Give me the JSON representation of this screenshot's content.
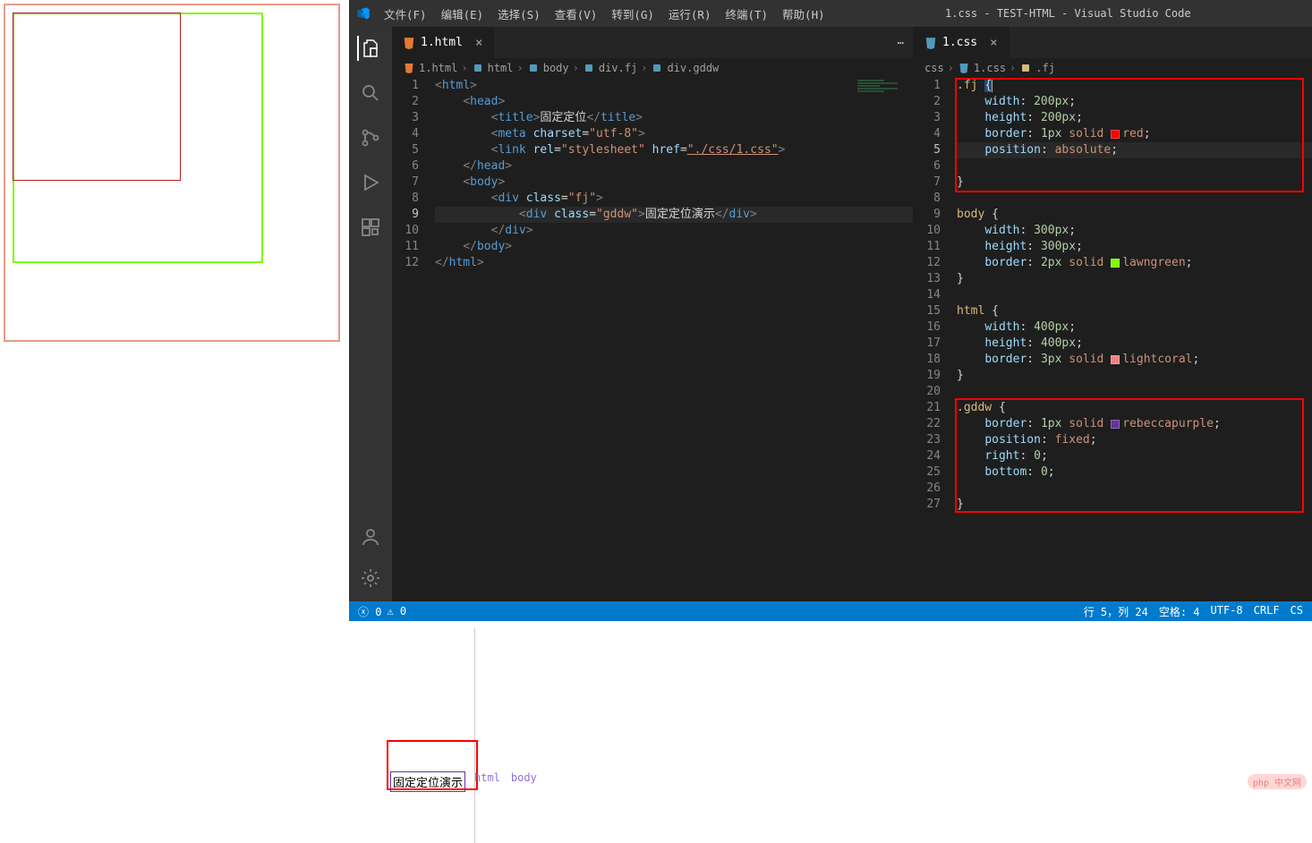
{
  "title_bar": {
    "app_title": "1.css - TEST-HTML - Visual Studio Code",
    "menu": [
      "文件(F)",
      "编辑(E)",
      "选择(S)",
      "查看(V)",
      "转到(G)",
      "运行(R)",
      "终端(T)",
      "帮助(H)"
    ]
  },
  "activity_bar": {
    "icons": [
      "files-icon",
      "search-icon",
      "source-control-icon",
      "run-debug-icon",
      "extensions-icon"
    ],
    "bottom_icons": [
      "account-icon",
      "gear-icon"
    ]
  },
  "left_editor": {
    "tab": {
      "name": "1.html",
      "icon": "html-file-icon"
    },
    "breadcrumb": [
      "1.html",
      "html",
      "body",
      "div.fj",
      "div.gddw"
    ],
    "current_line": 9,
    "lines": [
      {
        "n": 1,
        "indent": 0,
        "html": "<span class='t-br'>&lt;</span><span class='t-tag'>html</span><span class='t-br'>&gt;</span>"
      },
      {
        "n": 2,
        "indent": 1,
        "html": "<span class='t-br'>&lt;</span><span class='t-tag'>head</span><span class='t-br'>&gt;</span>"
      },
      {
        "n": 3,
        "indent": 2,
        "html": "<span class='t-br'>&lt;</span><span class='t-tag'>title</span><span class='t-br'>&gt;</span><span class='t-text'>固定定位</span><span class='t-br'>&lt;/</span><span class='t-tag'>title</span><span class='t-br'>&gt;</span>"
      },
      {
        "n": 4,
        "indent": 2,
        "html": "<span class='t-br'>&lt;</span><span class='t-tag'>meta</span> <span class='t-attr'>charset</span><span class='t-punc'>=</span><span class='t-str'>\"utf-8\"</span><span class='t-br'>&gt;</span>"
      },
      {
        "n": 5,
        "indent": 2,
        "html": "<span class='t-br'>&lt;</span><span class='t-tag'>link</span> <span class='t-attr'>rel</span><span class='t-punc'>=</span><span class='t-str'>\"stylesheet\"</span> <span class='t-attr'>href</span><span class='t-punc'>=</span><span class='t-link'>\"./css/1.css\"</span><span class='t-br'>&gt;</span>"
      },
      {
        "n": 6,
        "indent": 1,
        "html": "<span class='t-br'>&lt;/</span><span class='t-tag'>head</span><span class='t-br'>&gt;</span>"
      },
      {
        "n": 7,
        "indent": 1,
        "html": "<span class='t-br'>&lt;</span><span class='t-tag'>body</span><span class='t-br'>&gt;</span>"
      },
      {
        "n": 8,
        "indent": 2,
        "html": "<span class='t-br'>&lt;</span><span class='t-tag'>div</span> <span class='t-attr'>class</span><span class='t-punc'>=</span><span class='t-str'>\"fj\"</span><span class='t-br'>&gt;</span>"
      },
      {
        "n": 9,
        "indent": 3,
        "html": "<span class='t-br'>&lt;</span><span class='t-tag'>div</span> <span class='t-attr'>class</span><span class='t-punc'>=</span><span class='t-str'>\"gddw\"</span><span class='t-br'>&gt;</span><span class='t-text'>固定定位演示</span><span class='t-br'>&lt;/</span><span class='t-tag'>div</span><span class='t-br'>&gt;</span>"
      },
      {
        "n": 10,
        "indent": 2,
        "html": "<span class='t-br'>&lt;/</span><span class='t-tag'>div</span><span class='t-br'>&gt;</span>"
      },
      {
        "n": 11,
        "indent": 1,
        "html": "<span class='t-br'>&lt;/</span><span class='t-tag'>body</span><span class='t-br'>&gt;</span>"
      },
      {
        "n": 12,
        "indent": 0,
        "html": "<span class='t-br'>&lt;/</span><span class='t-tag'>html</span><span class='t-br'>&gt;</span>"
      }
    ]
  },
  "right_editor": {
    "tab": {
      "name": "1.css",
      "icon": "css-file-icon"
    },
    "breadcrumb_pre": "css",
    "breadcrumb_file": "1.css",
    "breadcrumb_sel": ".fj",
    "current_line": 5,
    "lines": [
      {
        "n": 1,
        "html": "<span class='t-sel'>.fj</span> <span class='sel-bg'><span class='t-punc'>{</span></span><span class='cursor'></span>"
      },
      {
        "n": 2,
        "html": "    <span class='t-prop'>width</span><span class='t-punc'>:</span> <span class='t-num'>200px</span><span class='t-punc'>;</span>"
      },
      {
        "n": 3,
        "html": "    <span class='t-prop'>height</span><span class='t-punc'>:</span> <span class='t-num'>200px</span><span class='t-punc'>;</span>"
      },
      {
        "n": 4,
        "html": "    <span class='t-prop'>border</span><span class='t-punc'>:</span> <span class='t-num'>1px</span> <span class='t-val'>solid</span> <span class='col-swatch' style='background:red'></span><span class='t-val'>red</span><span class='t-punc'>;</span>"
      },
      {
        "n": 5,
        "html": "    <span class='t-prop'>position</span><span class='t-punc'>:</span> <span class='t-val'>absolute</span><span class='t-punc'>;</span>"
      },
      {
        "n": 6,
        "html": ""
      },
      {
        "n": 7,
        "html": "<span class='t-punc'>}</span>"
      },
      {
        "n": 8,
        "html": ""
      },
      {
        "n": 9,
        "html": "<span class='t-sel'>body</span> <span class='t-punc'>{</span>"
      },
      {
        "n": 10,
        "html": "    <span class='t-prop'>width</span><span class='t-punc'>:</span> <span class='t-num'>300px</span><span class='t-punc'>;</span>"
      },
      {
        "n": 11,
        "html": "    <span class='t-prop'>height</span><span class='t-punc'>:</span> <span class='t-num'>300px</span><span class='t-punc'>;</span>"
      },
      {
        "n": 12,
        "html": "    <span class='t-prop'>border</span><span class='t-punc'>:</span> <span class='t-num'>2px</span> <span class='t-val'>solid</span> <span class='col-swatch' style='background:lawngreen'></span><span class='t-val'>lawngreen</span><span class='t-punc'>;</span>"
      },
      {
        "n": 13,
        "html": "<span class='t-punc'>}</span>"
      },
      {
        "n": 14,
        "html": ""
      },
      {
        "n": 15,
        "html": "<span class='t-sel'>html</span> <span class='t-punc'>{</span>"
      },
      {
        "n": 16,
        "html": "    <span class='t-prop'>width</span><span class='t-punc'>:</span> <span class='t-num'>400px</span><span class='t-punc'>;</span>"
      },
      {
        "n": 17,
        "html": "    <span class='t-prop'>height</span><span class='t-punc'>:</span> <span class='t-num'>400px</span><span class='t-punc'>;</span>"
      },
      {
        "n": 18,
        "html": "    <span class='t-prop'>border</span><span class='t-punc'>:</span> <span class='t-num'>3px</span> <span class='t-val'>solid</span> <span class='col-swatch' style='background:lightcoral'></span><span class='t-val'>lightcoral</span><span class='t-punc'>;</span>"
      },
      {
        "n": 19,
        "html": "<span class='t-punc'>}</span>"
      },
      {
        "n": 20,
        "html": ""
      },
      {
        "n": 21,
        "html": "<span class='t-sel'>.gddw</span> <span class='t-punc'>{</span>"
      },
      {
        "n": 22,
        "html": "    <span class='t-prop'>border</span><span class='t-punc'>:</span> <span class='t-num'>1px</span> <span class='t-val'>solid</span> <span class='col-swatch' style='background:rebeccapurple'></span><span class='t-val'>rebeccapurple</span><span class='t-punc'>;</span>"
      },
      {
        "n": 23,
        "html": "    <span class='t-prop'>position</span><span class='t-punc'>:</span> <span class='t-val'>fixed</span><span class='t-punc'>;</span>"
      },
      {
        "n": 24,
        "html": "    <span class='t-prop'>right</span><span class='t-punc'>:</span> <span class='t-num'>0</span><span class='t-punc'>;</span>"
      },
      {
        "n": 25,
        "html": "    <span class='t-prop'>bottom</span><span class='t-punc'>:</span> <span class='t-num'>0</span><span class='t-punc'>;</span>"
      },
      {
        "n": 26,
        "html": ""
      },
      {
        "n": 27,
        "html": "<span class='t-punc'>}</span>"
      }
    ]
  },
  "status_bar": {
    "errors": "0",
    "warnings": "0",
    "cursor": "行 5，列 24",
    "spaces": "空格: 4",
    "encoding": "UTF-8",
    "eol": "CRLF",
    "lang": "CS"
  },
  "bottom": {
    "gddw_text": "固定定位演示",
    "bc_html": "html",
    "bc_body": "body"
  },
  "watermark": "php 中文网"
}
